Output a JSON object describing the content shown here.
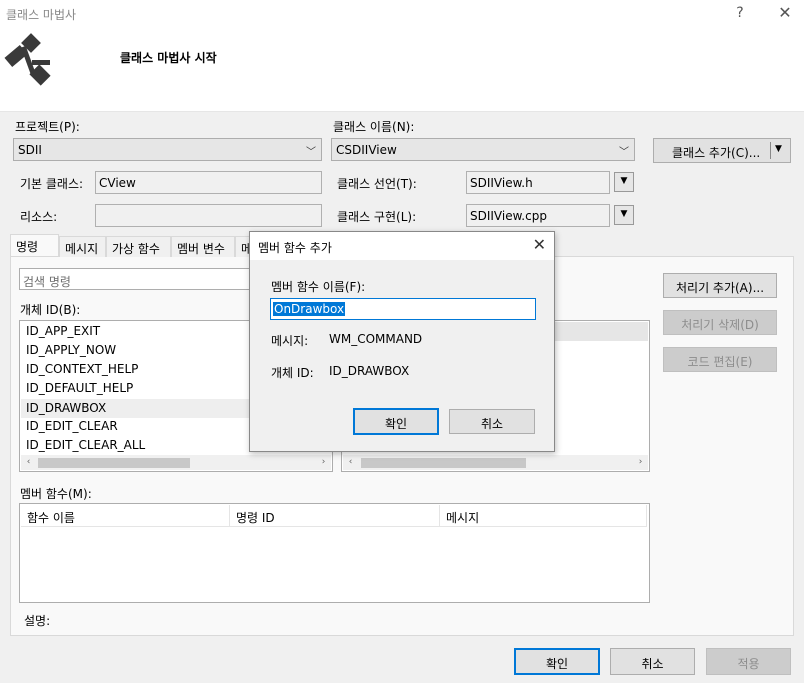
{
  "window": {
    "title": "클래스 마법사",
    "help": "?",
    "close": "✕"
  },
  "header": {
    "heading": "클래스 마법사 시작"
  },
  "project": {
    "label": "프로젝트(P):",
    "value": "SDII"
  },
  "class_name": {
    "label": "클래스 이름(N):",
    "value": "CSDIIView"
  },
  "add_class_button": "클래스 추가(C)...",
  "base_class": {
    "label": "기본 클래스:",
    "value": "CView"
  },
  "resource": {
    "label": "리소스:",
    "value": ""
  },
  "class_declaration": {
    "label": "클래스 선언(T):",
    "value": "SDIIView.h"
  },
  "class_implementation": {
    "label": "클래스 구현(L):",
    "value": "SDIIView.cpp"
  },
  "tabs": [
    "명령",
    "메시지",
    "가상 함수",
    "멤버 변수",
    "메"
  ],
  "search": {
    "placeholder": "검색 명령"
  },
  "object_ids": {
    "label": "개체 ID(B):",
    "items": [
      "ID_APP_EXIT",
      "ID_APPLY_NOW",
      "ID_CONTEXT_HELP",
      "ID_DEFAULT_HELP",
      "ID_DRAWBOX",
      "ID_EDIT_CLEAR",
      "ID_EDIT_CLEAR_ALL"
    ],
    "selected": "ID_DRAWBOX"
  },
  "right_buttons": {
    "add_handler": "처리기 추가(A)...",
    "delete_handler": "처리기 삭제(D)",
    "edit_code": "코드 편집(E)"
  },
  "member_functions": {
    "label": "멤버 함수(M):",
    "columns": [
      "함수 이름",
      "명령 ID",
      "메시지"
    ]
  },
  "description": {
    "label": "설명:"
  },
  "bottom_buttons": {
    "ok": "확인",
    "cancel": "취소",
    "apply": "적용"
  },
  "dialog": {
    "title": "멤버 함수 추가",
    "name_label": "멤버 함수 이름(F):",
    "name_value": "OnDrawbox",
    "message_label": "메시지:",
    "message_value": "WM_COMMAND",
    "object_id_label": "개체 ID:",
    "object_id_value": "ID_DRAWBOX",
    "ok": "확인",
    "cancel": "취소"
  },
  "icons": {
    "logo": "class-wizard-logo-icon",
    "dropdown": "chevron-down-icon",
    "scroll_left": "arrow-left-icon",
    "scroll_right": "arrow-right-icon"
  },
  "colors": {
    "accent": "#0078d7",
    "selection": "#0078d7",
    "background": "#f0f0f0"
  }
}
